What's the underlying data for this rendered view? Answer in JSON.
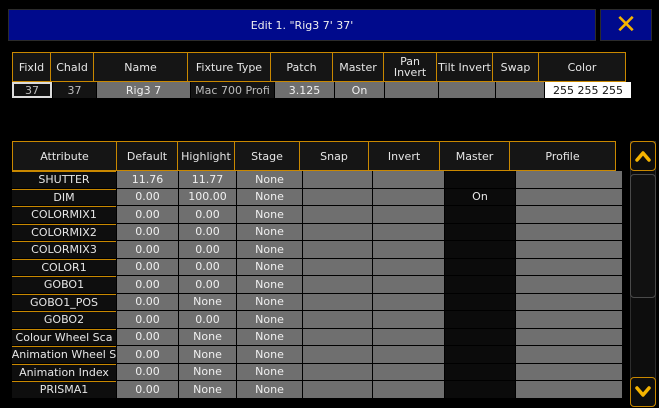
{
  "window": {
    "title": "Edit 1. \"Rig3 7' 37'",
    "close_icon": "close-icon",
    "close_color": "#f5b400"
  },
  "fixture_table": {
    "headers": [
      "FixId",
      "ChaId",
      "Name",
      "Fixture Type",
      "Patch",
      "Master",
      "Pan Invert",
      "Tilt Invert",
      "Swap",
      "Color"
    ],
    "row": {
      "fixid": "37",
      "chaid": "37",
      "name": "Rig3 7",
      "fixture_type": "Mac 700 Profi",
      "patch": "3.125",
      "master": "On",
      "pan_invert": "",
      "tilt_invert": "",
      "swap": "",
      "color": "255 255 255"
    }
  },
  "attribute_table": {
    "headers": [
      "Attribute",
      "Default",
      "Highlight",
      "Stage",
      "Snap",
      "Invert",
      "Master",
      "Profile"
    ],
    "rows": [
      {
        "attribute": "SHUTTER",
        "default": "11.76",
        "highlight": "11.77",
        "stage": "None",
        "snap": "",
        "invert": "",
        "master": "",
        "profile": ""
      },
      {
        "attribute": "DIM",
        "default": "0.00",
        "highlight": "100.00",
        "stage": "None",
        "snap": "",
        "invert": "",
        "master": "On",
        "profile": ""
      },
      {
        "attribute": "COLORMIX1",
        "default": "0.00",
        "highlight": "0.00",
        "stage": "None",
        "snap": "",
        "invert": "",
        "master": "",
        "profile": ""
      },
      {
        "attribute": "COLORMIX2",
        "default": "0.00",
        "highlight": "0.00",
        "stage": "None",
        "snap": "",
        "invert": "",
        "master": "",
        "profile": ""
      },
      {
        "attribute": "COLORMIX3",
        "default": "0.00",
        "highlight": "0.00",
        "stage": "None",
        "snap": "",
        "invert": "",
        "master": "",
        "profile": ""
      },
      {
        "attribute": "COLOR1",
        "default": "0.00",
        "highlight": "0.00",
        "stage": "None",
        "snap": "",
        "invert": "",
        "master": "",
        "profile": ""
      },
      {
        "attribute": "GOBO1",
        "default": "0.00",
        "highlight": "0.00",
        "stage": "None",
        "snap": "",
        "invert": "",
        "master": "",
        "profile": ""
      },
      {
        "attribute": "GOBO1_POS",
        "default": "0.00",
        "highlight": "None",
        "stage": "None",
        "snap": "",
        "invert": "",
        "master": "",
        "profile": ""
      },
      {
        "attribute": "GOBO2",
        "default": "0.00",
        "highlight": "0.00",
        "stage": "None",
        "snap": "",
        "invert": "",
        "master": "",
        "profile": ""
      },
      {
        "attribute": "Colour Wheel Sca",
        "default": "0.00",
        "highlight": "None",
        "stage": "None",
        "snap": "",
        "invert": "",
        "master": "",
        "profile": ""
      },
      {
        "attribute": "Animation Wheel S",
        "default": "0.00",
        "highlight": "None",
        "stage": "None",
        "snap": "",
        "invert": "",
        "master": "",
        "profile": ""
      },
      {
        "attribute": "Animation Index",
        "default": "0.00",
        "highlight": "None",
        "stage": "None",
        "snap": "",
        "invert": "",
        "master": "",
        "profile": ""
      },
      {
        "attribute": "PRISMA1",
        "default": "0.00",
        "highlight": "None",
        "stage": "None",
        "snap": "",
        "invert": "",
        "master": "",
        "profile": ""
      }
    ]
  },
  "scroll": {
    "up_icon": "chevron-up-icon",
    "down_icon": "chevron-down-icon",
    "accent": "#f5b400"
  }
}
